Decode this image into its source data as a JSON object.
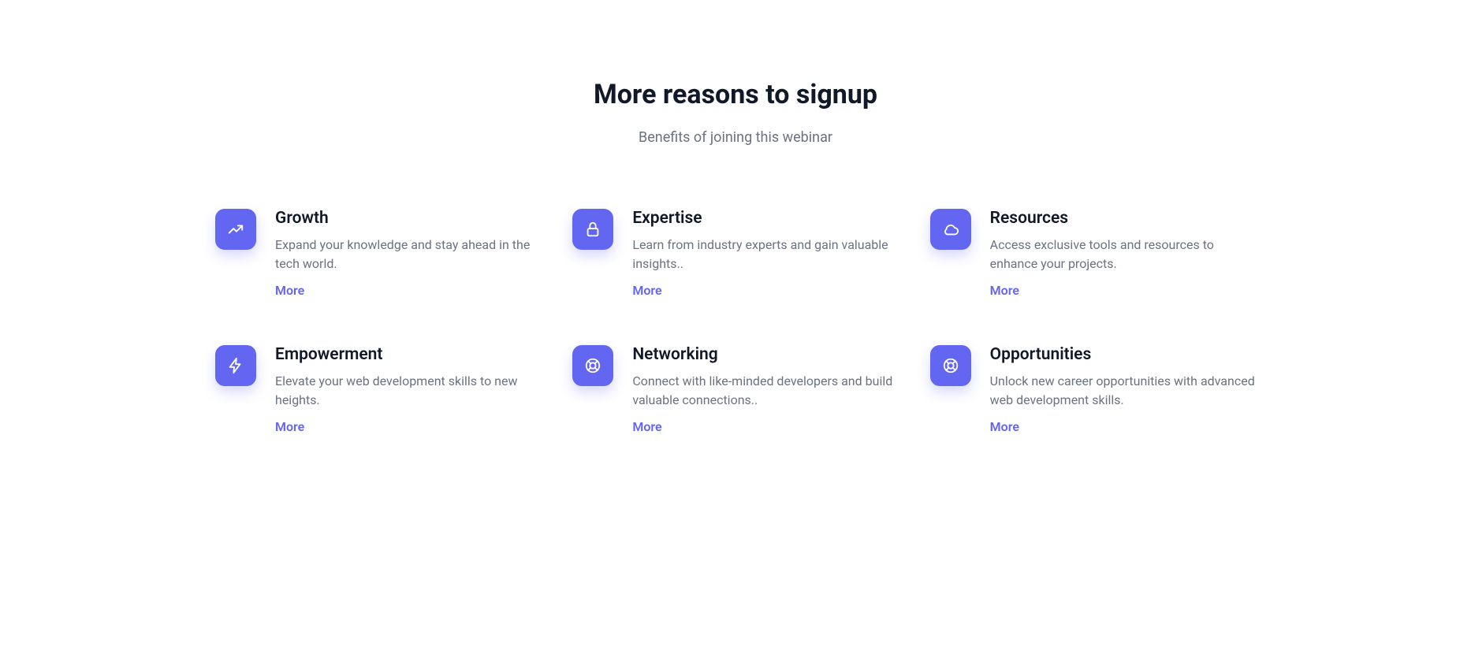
{
  "header": {
    "title": "More reasons to signup",
    "subtitle": "Benefits of joining this webinar"
  },
  "items": [
    {
      "title": "Growth",
      "desc": "Expand your knowledge and stay ahead in the tech world.",
      "more": "More",
      "icon": "trending-up"
    },
    {
      "title": "Expertise",
      "desc": "Learn from industry experts and gain valuable insights..",
      "more": "More",
      "icon": "lock"
    },
    {
      "title": "Resources",
      "desc": "Access exclusive tools and resources to enhance your projects.",
      "more": "More",
      "icon": "cloud"
    },
    {
      "title": "Empowerment",
      "desc": "Elevate your web development skills to new heights.",
      "more": "More",
      "icon": "bolt"
    },
    {
      "title": "Networking",
      "desc": "Connect with like-minded developers and build valuable connections..",
      "more": "More",
      "icon": "lifebuoy"
    },
    {
      "title": "Opportunities",
      "desc": "Unlock new career opportunities with advanced web development skills.",
      "more": "More",
      "icon": "lifebuoy"
    }
  ]
}
